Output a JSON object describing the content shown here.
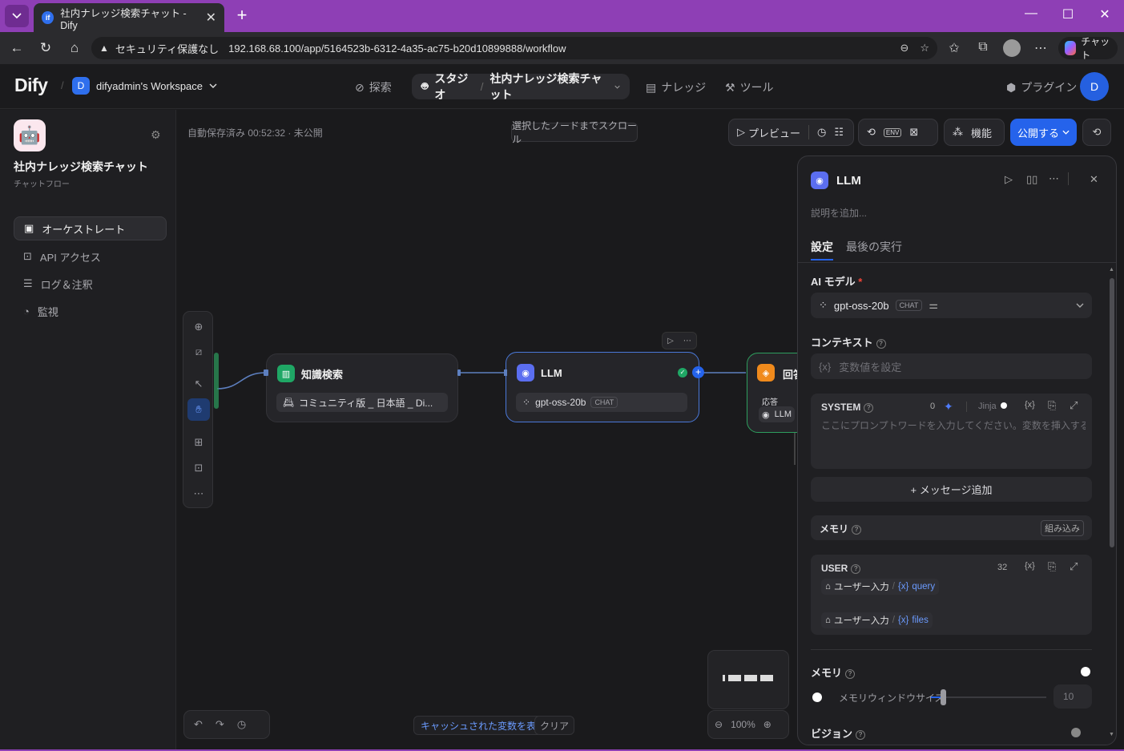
{
  "browser": {
    "tab_title": "社内ナレッジ検索チャット - Dify",
    "tab_favicon": "if",
    "address": {
      "security_label": "セキュリティ保護なし",
      "url": "192.168.68.100/app/5164523b-6312-4a35-ac75-b20d10899888/workflow"
    },
    "chat_button": "チャット"
  },
  "header": {
    "logo": "Dify",
    "workspace_initial": "D",
    "workspace_name": "difyadmin's Workspace",
    "nav": {
      "explore": "探索",
      "studio": "スタジオ",
      "app_name": "社内ナレッジ検索チャット",
      "knowledge": "ナレッジ",
      "tools": "ツール",
      "plugins": "プラグイン"
    },
    "user_initial": "D"
  },
  "sidebar": {
    "app_icon": "🤖",
    "app_title": "社内ナレッジ検索チャット",
    "app_type": "チャットフロー",
    "items": [
      {
        "label": "オーケストレート",
        "icon": "window-icon"
      },
      {
        "label": "API アクセス",
        "icon": "terminal-icon"
      },
      {
        "label": "ログ＆注釈",
        "icon": "log-icon"
      },
      {
        "label": "監視",
        "icon": "gauge-icon"
      }
    ]
  },
  "canvas": {
    "status": "自動保存済み 00:52:32 · 未公開",
    "scroll_to_node": "選択したノードまでスクロール",
    "preview": "プレビュー",
    "features": "機能",
    "publish": "公開する",
    "nodes": {
      "knowledge": {
        "title": "知識検索",
        "dataset": "コミュニティ版 _ 日本語 _ Di..."
      },
      "llm": {
        "title": "LLM",
        "model": "gpt-oss-20b",
        "mode": "CHAT"
      },
      "answer": {
        "title": "回答",
        "label": "応答",
        "ref": "LLM"
      }
    },
    "show_cached_vars": "キャッシュされた変数を表示",
    "clear": "クリア",
    "zoom": "100%"
  },
  "panel": {
    "title": "LLM",
    "description_placeholder": "説明を追加...",
    "tabs": [
      "設定",
      "最後の実行"
    ],
    "ai_model_label": "AI モデル",
    "required_mark": "*",
    "model_name": "gpt-oss-20b",
    "model_mode": "CHAT",
    "context_label": "コンテキスト",
    "context_placeholder": "変数値を設定",
    "system": {
      "label": "SYSTEM",
      "count": "0",
      "jinja": "Jinja",
      "placeholder": "ここにプロンプトワードを入力してください。変数を挿入するには「..."
    },
    "add_message": "+ メッセージ追加",
    "memory_label": "メモリ",
    "builtin": "組み込み",
    "user": {
      "label": "USER",
      "count": "32",
      "line1_prefix": "ユーザー入力",
      "line1_var": "query",
      "line2_prefix": "ユーザー入力",
      "line2_var": "files"
    },
    "memory_toggle_label": "メモリ",
    "memory_enabled": true,
    "memory_window_label": "メモリウィンドウサイズ",
    "memory_window_value": "10",
    "vision_label": "ビジョン"
  }
}
